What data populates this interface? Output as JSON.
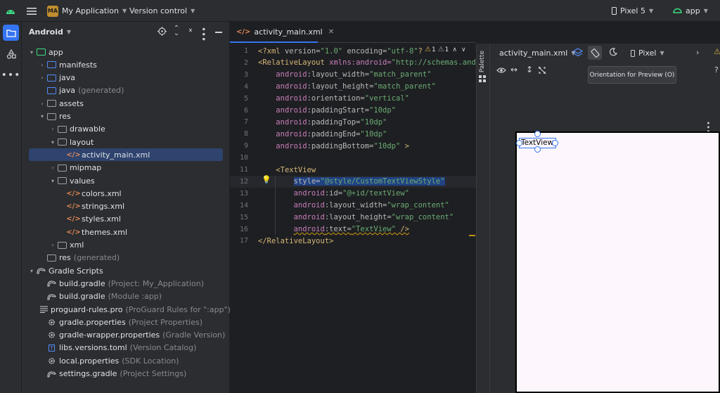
{
  "topbar": {
    "project_badge": "MA",
    "project_name": "My Application",
    "vcs": "Version control",
    "device": "Pixel 5",
    "run_config": "app"
  },
  "project_panel": {
    "title": "Android",
    "tree": [
      {
        "label": "app",
        "extra": ""
      },
      {
        "label": "manifests",
        "extra": ""
      },
      {
        "label": "java",
        "extra": ""
      },
      {
        "label": "java",
        "extra": "(generated)"
      },
      {
        "label": "assets",
        "extra": ""
      },
      {
        "label": "res",
        "extra": ""
      },
      {
        "label": "drawable",
        "extra": ""
      },
      {
        "label": "layout",
        "extra": ""
      },
      {
        "label": "activity_main.xml",
        "extra": ""
      },
      {
        "label": "mipmap",
        "extra": ""
      },
      {
        "label": "values",
        "extra": ""
      },
      {
        "label": "colors.xml",
        "extra": ""
      },
      {
        "label": "strings.xml",
        "extra": ""
      },
      {
        "label": "styles.xml",
        "extra": ""
      },
      {
        "label": "themes.xml",
        "extra": ""
      },
      {
        "label": "xml",
        "extra": ""
      },
      {
        "label": "res",
        "extra": "(generated)"
      },
      {
        "label": "Gradle Scripts",
        "extra": ""
      },
      {
        "label": "build.gradle",
        "extra": "(Project: My_Application)"
      },
      {
        "label": "build.gradle",
        "extra": "(Module :app)"
      },
      {
        "label": "proguard-rules.pro",
        "extra": "(ProGuard Rules for \":app\")"
      },
      {
        "label": "gradle.properties",
        "extra": "(Project Properties)"
      },
      {
        "label": "gradle-wrapper.properties",
        "extra": "(Gradle Version)"
      },
      {
        "label": "libs.versions.toml",
        "extra": "(Version Catalog)"
      },
      {
        "label": "local.properties",
        "extra": "(SDK Location)"
      },
      {
        "label": "settings.gradle",
        "extra": "(Project Settings)"
      }
    ]
  },
  "editor": {
    "tab": "activity_main.xml",
    "warnings": "1",
    "checks": "1",
    "lines": [
      {
        "n": "1",
        "parts": [
          [
            "tag",
            "<?xml "
          ],
          [
            "attr",
            "version="
          ],
          [
            "str",
            "\"1.0\""
          ],
          [
            "attr",
            " encoding="
          ],
          [
            "str",
            "\"utf-8\""
          ],
          [
            "tag",
            "?>"
          ]
        ]
      },
      {
        "n": "2",
        "parts": [
          [
            "tag",
            "<RelativeLayout "
          ],
          [
            "attr-ns",
            "xmlns:android="
          ],
          [
            "str",
            "\"http://schemas.andro"
          ]
        ]
      },
      {
        "n": "3",
        "parts": [
          [
            "attr",
            "    "
          ],
          [
            "attr-ns",
            "android"
          ],
          [
            "attr",
            ":layout_width="
          ],
          [
            "str",
            "\"match_parent\""
          ]
        ]
      },
      {
        "n": "4",
        "parts": [
          [
            "attr",
            "    "
          ],
          [
            "attr-ns",
            "android"
          ],
          [
            "attr",
            ":layout_height="
          ],
          [
            "str",
            "\"match_parent\""
          ]
        ]
      },
      {
        "n": "5",
        "parts": [
          [
            "attr",
            "    "
          ],
          [
            "attr-ns",
            "android"
          ],
          [
            "attr",
            ":orientation="
          ],
          [
            "str",
            "\"vertical\""
          ]
        ]
      },
      {
        "n": "6",
        "parts": [
          [
            "attr",
            "    "
          ],
          [
            "attr-ns",
            "android"
          ],
          [
            "attr",
            ":paddingStart="
          ],
          [
            "str",
            "\"10dp\""
          ]
        ]
      },
      {
        "n": "7",
        "parts": [
          [
            "attr",
            "    "
          ],
          [
            "attr-ns",
            "android"
          ],
          [
            "attr",
            ":paddingTop="
          ],
          [
            "str",
            "\"10dp\""
          ]
        ]
      },
      {
        "n": "8",
        "parts": [
          [
            "attr",
            "    "
          ],
          [
            "attr-ns",
            "android"
          ],
          [
            "attr",
            ":paddingEnd="
          ],
          [
            "str",
            "\"10dp\""
          ]
        ]
      },
      {
        "n": "9",
        "parts": [
          [
            "attr",
            "    "
          ],
          [
            "attr-ns",
            "android"
          ],
          [
            "attr",
            ":paddingBottom="
          ],
          [
            "str",
            "\"10dp\""
          ],
          [
            "tag",
            " >"
          ]
        ]
      },
      {
        "n": "10",
        "parts": []
      },
      {
        "n": "11",
        "parts": [
          [
            "attr",
            "    "
          ],
          [
            "tag",
            "<TextView"
          ]
        ]
      },
      {
        "n": "12",
        "parts": [
          [
            "attr",
            "        "
          ],
          [
            "attr",
            "style="
          ],
          [
            "str",
            "\"@style/CustomTextViewStyle\""
          ]
        ]
      },
      {
        "n": "13",
        "parts": [
          [
            "attr",
            "        "
          ],
          [
            "attr-ns",
            "android"
          ],
          [
            "attr",
            ":id="
          ],
          [
            "str",
            "\"@+id/textView\""
          ]
        ]
      },
      {
        "n": "14",
        "parts": [
          [
            "attr",
            "        "
          ],
          [
            "attr-ns",
            "android"
          ],
          [
            "attr",
            ":layout_width="
          ],
          [
            "str",
            "\"wrap_content\""
          ]
        ]
      },
      {
        "n": "15",
        "parts": [
          [
            "attr",
            "        "
          ],
          [
            "attr-ns",
            "android"
          ],
          [
            "attr",
            ":layout_height="
          ],
          [
            "str",
            "\"wrap_content\""
          ]
        ]
      },
      {
        "n": "16",
        "parts": [
          [
            "attr",
            "        "
          ],
          [
            "attr-ns",
            "android"
          ],
          [
            "attr",
            ":text="
          ],
          [
            "str",
            "\"TextView\""
          ],
          [
            "tag",
            " />"
          ]
        ]
      },
      {
        "n": "17",
        "parts": [
          [
            "tag",
            "</RelativeLayout>"
          ]
        ]
      }
    ]
  },
  "palette": {
    "label": "Palette"
  },
  "design": {
    "file": "activity_main.xml",
    "device": "Pixel",
    "tooltip": "Orientation for Preview (O)",
    "preview_text": "TextView"
  }
}
